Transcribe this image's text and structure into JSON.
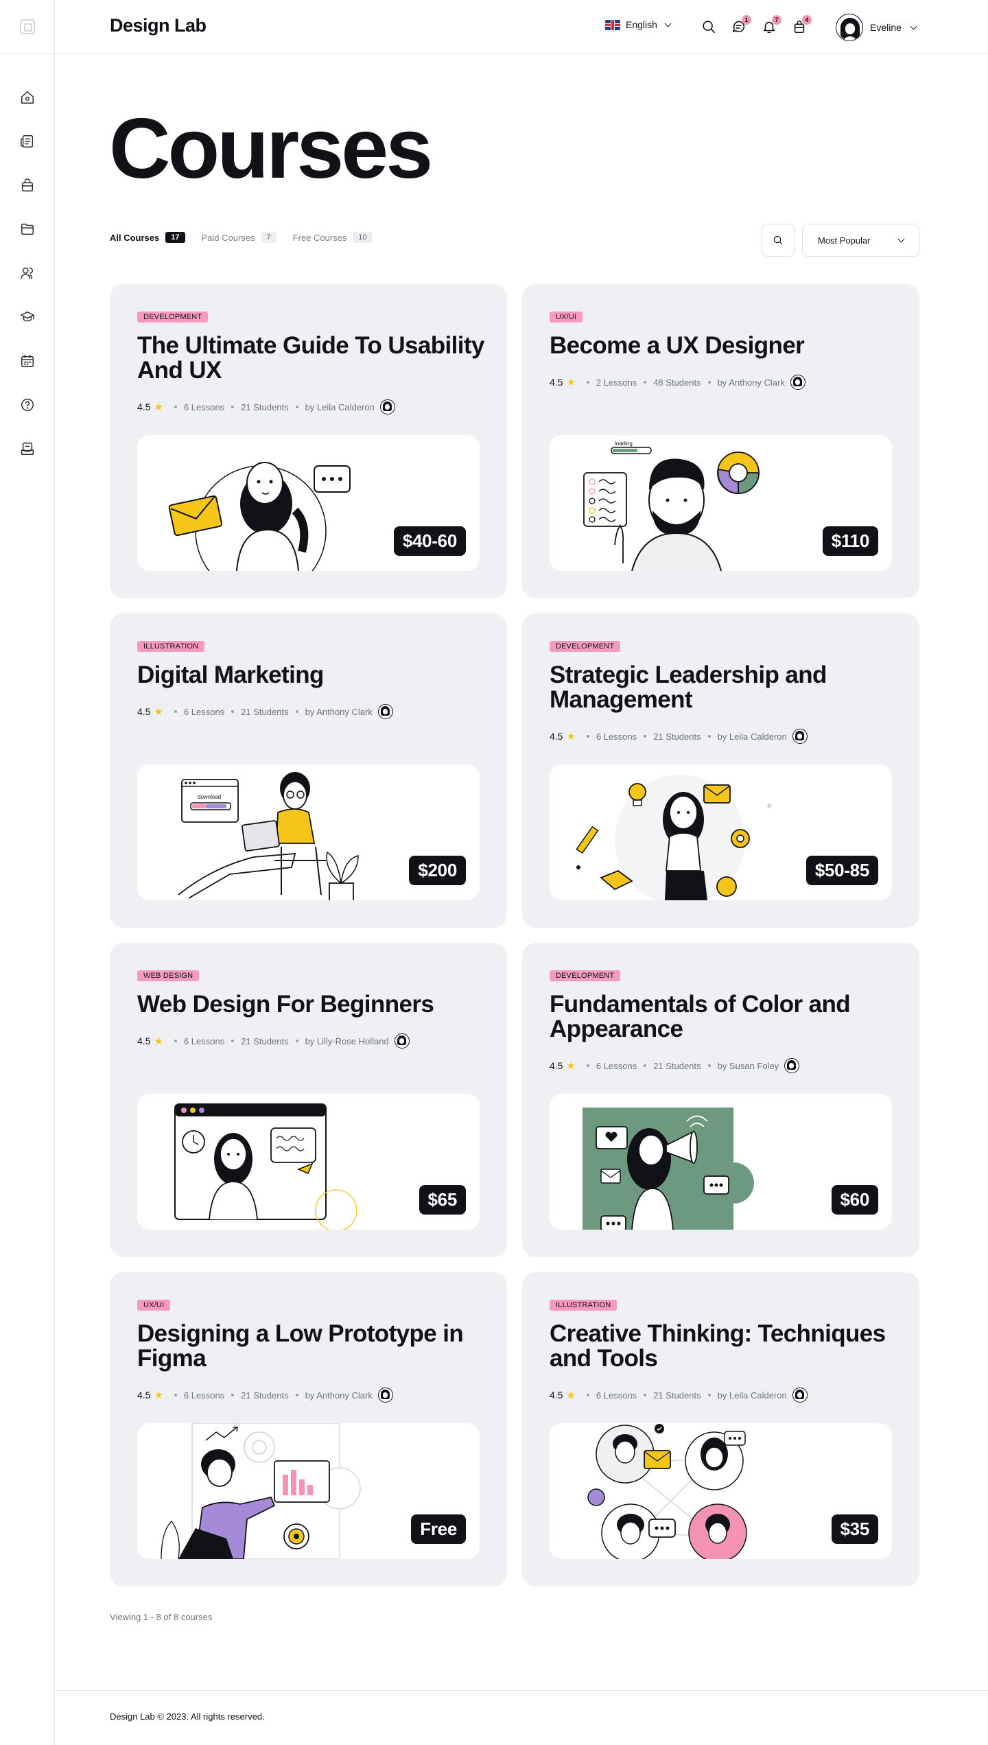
{
  "brand": "Design Lab",
  "header": {
    "language": "English",
    "messages_count": "1",
    "notifications_count": "7",
    "bag_count": "4",
    "user_name": "Eveline"
  },
  "page_title": "Courses",
  "tabs": [
    {
      "label": "All Courses",
      "count": "17"
    },
    {
      "label": "Paid Courses",
      "count": "7"
    },
    {
      "label": "Free Courses",
      "count": "10"
    }
  ],
  "sort": {
    "selected": "Most Popular"
  },
  "courses": [
    {
      "tag": "DEVELOPMENT",
      "title": "The Ultimate Guide To Usability And UX",
      "rating": "4.5",
      "lessons": "6 Lessons",
      "students": "21 Students",
      "author": "by Leila Calderon",
      "price": "$40-60"
    },
    {
      "tag": "UX/UI",
      "title": "Become a UX Designer",
      "rating": "4.5",
      "lessons": "2 Lessons",
      "students": "48 Students",
      "author": "by Anthony Clark",
      "price": "$110"
    },
    {
      "tag": "ILLUSTRATION",
      "title": "Digital Marketing",
      "rating": "4.5",
      "lessons": "6 Lessons",
      "students": "21 Students",
      "author": "by Anthony Clark",
      "price": "$200"
    },
    {
      "tag": "DEVELOPMENT",
      "title": "Strategic Leadership and Management",
      "rating": "4.5",
      "lessons": "6 Lessons",
      "students": "21 Students",
      "author": "by Leila Calderon",
      "price": "$50-85"
    },
    {
      "tag": "WEB DESIGN",
      "title": "Web Design For Beginners",
      "rating": "4.5",
      "lessons": "6 Lessons",
      "students": "21 Students",
      "author": "by Lilly-Rose Holland",
      "price": "$65"
    },
    {
      "tag": "DEVELOPMENT",
      "title": "Fundamentals of Color and Appearance",
      "rating": "4.5",
      "lessons": "6 Lessons",
      "students": "21 Students",
      "author": "by Susan Foley",
      "price": "$60"
    },
    {
      "tag": "UX/UI",
      "title": "Designing a Low Prototype in Figma",
      "rating": "4.5",
      "lessons": "6 Lessons",
      "students": "21 Students",
      "author": "by Anthony Clark",
      "price": "Free"
    },
    {
      "tag": "ILLUSTRATION",
      "title": "Creative Thinking: Techniques and Tools",
      "rating": "4.5",
      "lessons": "6 Lessons",
      "students": "21 Students",
      "author": "by Leila Calderon",
      "price": "$35"
    }
  ],
  "illustration_text": {
    "loading": "loading",
    "download": "download"
  },
  "viewing": "Viewing 1 - 8 of 8 courses",
  "footer": "Design Lab © 2023. All rights reserved.",
  "colors": {
    "accent_pink": "#f69bbd",
    "card_bg": "#eef0f4",
    "dark": "#101218",
    "star": "#f5c518"
  }
}
